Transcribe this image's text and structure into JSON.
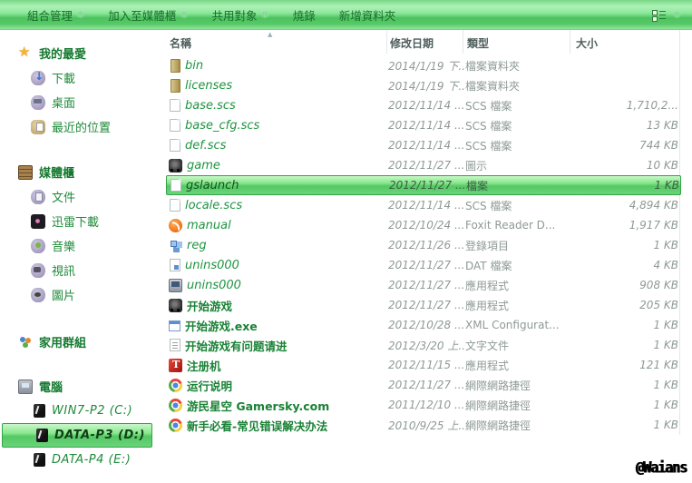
{
  "toolbar": {
    "items": [
      {
        "name": "organize",
        "label": "組合管理",
        "dropdown": true
      },
      {
        "name": "add-to-library",
        "label": "加入至媒體櫃",
        "dropdown": true
      },
      {
        "name": "share-with",
        "label": "共用對象",
        "dropdown": true
      },
      {
        "name": "burn",
        "label": "燒錄",
        "dropdown": false
      },
      {
        "name": "new-folder",
        "label": "新增資料夾",
        "dropdown": false
      }
    ],
    "dropdown_glyph": "❅",
    "view_icons": [
      "list-view-icon",
      "view-dropdown-icon"
    ]
  },
  "sidebar": {
    "items": [
      {
        "name": "favorites",
        "icon": "star-icon",
        "label": "我的最愛",
        "level": "section",
        "gap": "",
        "selected": false
      },
      {
        "name": "downloads",
        "icon": "download-icon",
        "label": "下載",
        "level": "child",
        "gap": "",
        "selected": false
      },
      {
        "name": "desktop",
        "icon": "desktop-icon",
        "label": "桌面",
        "level": "child",
        "gap": "",
        "selected": false
      },
      {
        "name": "recent-places",
        "icon": "recent-icon",
        "label": "最近的位置",
        "level": "child",
        "gap": "",
        "selected": false
      },
      {
        "name": "libraries",
        "icon": "libraries-icon",
        "label": "媒體櫃",
        "level": "section",
        "gap": "gap-a",
        "selected": false
      },
      {
        "name": "documents",
        "icon": "documents-icon",
        "label": "文件",
        "level": "child",
        "gap": "",
        "selected": false
      },
      {
        "name": "thunder-downloads",
        "icon": "thunder-icon",
        "label": "迅雷下載",
        "level": "child",
        "gap": "",
        "selected": false
      },
      {
        "name": "music",
        "icon": "music-icon",
        "label": "音樂",
        "level": "child",
        "gap": "",
        "selected": false
      },
      {
        "name": "videos",
        "icon": "videos-icon",
        "label": "視訊",
        "level": "child",
        "gap": "",
        "selected": false
      },
      {
        "name": "pictures",
        "icon": "pictures-icon",
        "label": "圖片",
        "level": "child",
        "gap": "",
        "selected": false
      },
      {
        "name": "homegroup",
        "icon": "homegroup-icon",
        "label": "家用群組",
        "level": "section",
        "gap": "gap-b",
        "selected": false
      },
      {
        "name": "computer",
        "icon": "computer-icon",
        "label": "電腦",
        "level": "section",
        "gap": "gap-c",
        "selected": false
      },
      {
        "name": "drive-c",
        "icon": "drive-icon",
        "label": "WIN7-P2 (C:)",
        "level": "drive",
        "gap": "",
        "selected": false
      },
      {
        "name": "drive-d",
        "icon": "drive-icon",
        "label": "DATA-P3 (D:)",
        "level": "drive",
        "gap": "",
        "selected": true
      },
      {
        "name": "drive-e",
        "icon": "drive-icon",
        "label": "DATA-P4 (E:)",
        "level": "drive",
        "gap": "",
        "selected": false
      }
    ]
  },
  "list": {
    "columns": [
      {
        "key": "name",
        "label": "名稱"
      },
      {
        "key": "date",
        "label": "修改日期"
      },
      {
        "key": "type",
        "label": "類型"
      },
      {
        "key": "size",
        "label": "大小"
      }
    ],
    "sort_glyph": "▲",
    "rows": [
      {
        "icon": "folder-icon",
        "name": "bin",
        "cjk": false,
        "date": "2014/1/19 下...",
        "type": "檔案資料夾",
        "size": "",
        "selected": false
      },
      {
        "icon": "folder-icon",
        "name": "licenses",
        "cjk": false,
        "date": "2014/1/19 下...",
        "type": "檔案資料夾",
        "size": "",
        "selected": false
      },
      {
        "icon": "file-icon",
        "name": "base.scs",
        "cjk": false,
        "date": "2012/11/14 ...",
        "type": "SCS 檔案",
        "size": "1,710,2...",
        "selected": false
      },
      {
        "icon": "file-icon",
        "name": "base_cfg.scs",
        "cjk": false,
        "date": "2012/11/14 ...",
        "type": "SCS 檔案",
        "size": "13 KB",
        "selected": false
      },
      {
        "icon": "file-icon",
        "name": "def.scs",
        "cjk": false,
        "date": "2012/11/14 ...",
        "type": "SCS 檔案",
        "size": "744 KB",
        "selected": false
      },
      {
        "icon": "truck-icon",
        "name": "game",
        "cjk": false,
        "date": "2012/11/27 ...",
        "type": "圖示",
        "size": "10 KB",
        "selected": false
      },
      {
        "icon": "file-icon",
        "name": "gslaunch",
        "cjk": false,
        "date": "2012/11/27 ...",
        "type": "檔案",
        "size": "1 KB",
        "selected": true
      },
      {
        "icon": "file-icon",
        "name": "locale.scs",
        "cjk": false,
        "date": "2012/11/14 ...",
        "type": "SCS 檔案",
        "size": "4,894 KB",
        "selected": false
      },
      {
        "icon": "foxit-icon",
        "name": "manual",
        "cjk": false,
        "date": "2012/10/24 ...",
        "type": "Foxit Reader D...",
        "size": "1,917 KB",
        "selected": false
      },
      {
        "icon": "reg-icon",
        "name": "reg",
        "cjk": false,
        "date": "2012/11/26 ...",
        "type": "登錄項目",
        "size": "1 KB",
        "selected": false
      },
      {
        "icon": "dat-icon",
        "name": "unins000",
        "cjk": false,
        "date": "2012/11/27 ...",
        "type": "DAT 檔案",
        "size": "4 KB",
        "selected": false
      },
      {
        "icon": "setup-icon",
        "name": "unins000",
        "cjk": false,
        "date": "2012/11/27 ...",
        "type": "應用程式",
        "size": "908 KB",
        "selected": false
      },
      {
        "icon": "truck-icon",
        "name": "开始游戏",
        "cjk": true,
        "date": "2012/11/27 ...",
        "type": "應用程式",
        "size": "205 KB",
        "selected": false
      },
      {
        "icon": "xml-icon",
        "name": "开始游戏.exe",
        "cjk": true,
        "date": "2012/10/28 ...",
        "type": "XML Configurat...",
        "size": "1 KB",
        "selected": false
      },
      {
        "icon": "text-icon",
        "name": "开始游戏有问题请进",
        "cjk": true,
        "date": "2012/3/20 上...",
        "type": "文字文件",
        "size": "1 KB",
        "selected": false
      },
      {
        "icon": "keygen-icon",
        "name": "注册机",
        "cjk": true,
        "date": "2012/11/15 ...",
        "type": "應用程式",
        "size": "121 KB",
        "selected": false
      },
      {
        "icon": "chrome-icon",
        "name": "运行说明",
        "cjk": true,
        "date": "2012/11/27 ...",
        "type": "網際網路捷徑",
        "size": "1 KB",
        "selected": false
      },
      {
        "icon": "chrome-icon",
        "name": "游民星空 Gamersky.com",
        "cjk": true,
        "date": "2011/12/10 ...",
        "type": "網際網路捷徑",
        "size": "1 KB",
        "selected": false
      },
      {
        "icon": "chrome-icon",
        "name": "新手必看-常见错误解决办法",
        "cjk": true,
        "date": "2010/9/25 上...",
        "type": "網際網路捷徑",
        "size": "1 KB",
        "selected": false
      }
    ]
  },
  "watermark": "@Waians"
}
